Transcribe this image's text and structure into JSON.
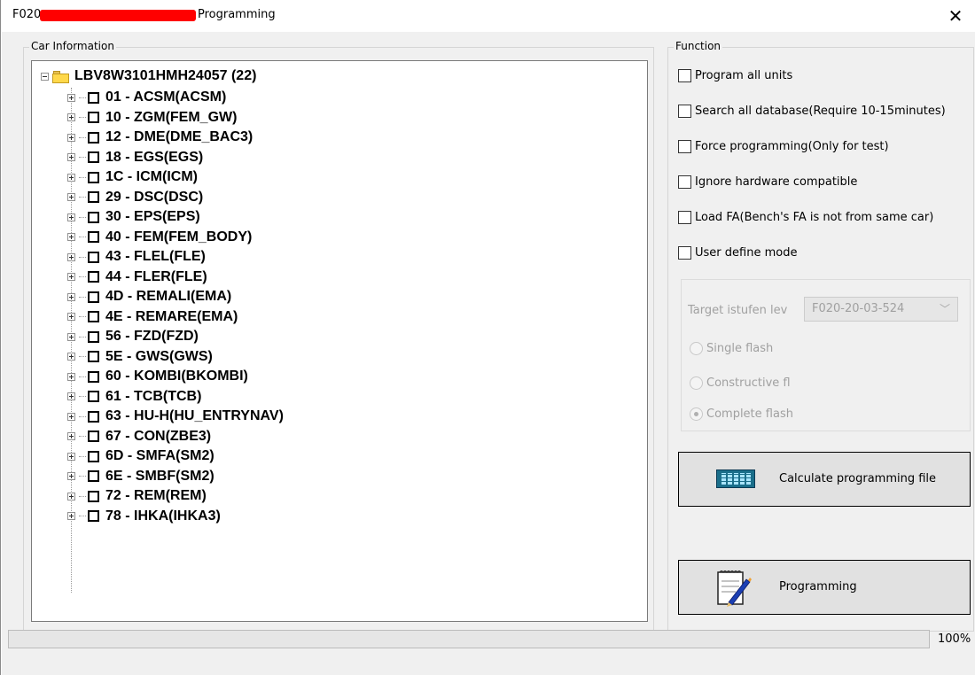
{
  "window": {
    "title_prefix": "F020",
    "title_suffix": "Programming",
    "redaction_color": "#ff0000"
  },
  "car_info": {
    "label": "Car Information",
    "root": {
      "label": "LBV8W3101HMH24057 (22)",
      "icon": "folder-icon"
    },
    "units": [
      {
        "label": "01 - ACSM(ACSM)",
        "checked": false
      },
      {
        "label": "10 - ZGM(FEM_GW)",
        "checked": false
      },
      {
        "label": "12 - DME(DME_BAC3)",
        "checked": false
      },
      {
        "label": "18 - EGS(EGS)",
        "checked": false
      },
      {
        "label": "1C - ICM(ICM)",
        "checked": false
      },
      {
        "label": "29 - DSC(DSC)",
        "checked": false
      },
      {
        "label": "30 - EPS(EPS)",
        "checked": false
      },
      {
        "label": "40 - FEM(FEM_BODY)",
        "checked": false
      },
      {
        "label": "43 - FLEL(FLE)",
        "checked": false
      },
      {
        "label": "44 - FLER(FLE)",
        "checked": false
      },
      {
        "label": "4D - REMALI(EMA)",
        "checked": false
      },
      {
        "label": "4E - REMARE(EMA)",
        "checked": false
      },
      {
        "label": "56 - FZD(FZD)",
        "checked": false
      },
      {
        "label": "5E - GWS(GWS)",
        "checked": false
      },
      {
        "label": "60 - KOMBI(BKOMBI)",
        "checked": false
      },
      {
        "label": "61 - TCB(TCB)",
        "checked": false
      },
      {
        "label": "63 - HU-H(HU_ENTRYNAV)",
        "checked": false
      },
      {
        "label": "67 - CON(ZBE3)",
        "checked": false
      },
      {
        "label": "6D - SMFA(SM2)",
        "checked": false
      },
      {
        "label": "6E - SMBF(SM2)",
        "checked": false
      },
      {
        "label": "72 - REM(REM)",
        "checked": false
      },
      {
        "label": "78 - IHKA(IHKA3)",
        "checked": false
      }
    ]
  },
  "function": {
    "label": "Function",
    "options": [
      {
        "label": "Program all units",
        "checked": false
      },
      {
        "label": "Search all database(Require 10-15minutes)",
        "checked": false
      },
      {
        "label": "Force programming(Only for test)",
        "checked": false
      },
      {
        "label": "Ignore hardware compatible",
        "checked": false
      },
      {
        "label": "Load FA(Bench's FA is not from same car)",
        "checked": false
      },
      {
        "label": "User define mode",
        "checked": false
      }
    ],
    "target_label": "Target istufen lev",
    "target_value": "F020-20-03-524",
    "flash_modes": [
      {
        "label": "Single flash",
        "selected": false
      },
      {
        "label": "Constructive fl",
        "selected": false
      },
      {
        "label": "Complete flash",
        "selected": true
      }
    ],
    "calc_button": "Calculate programming file",
    "program_button": "Programming"
  },
  "progress": {
    "value": 1.0,
    "label": "100%"
  }
}
